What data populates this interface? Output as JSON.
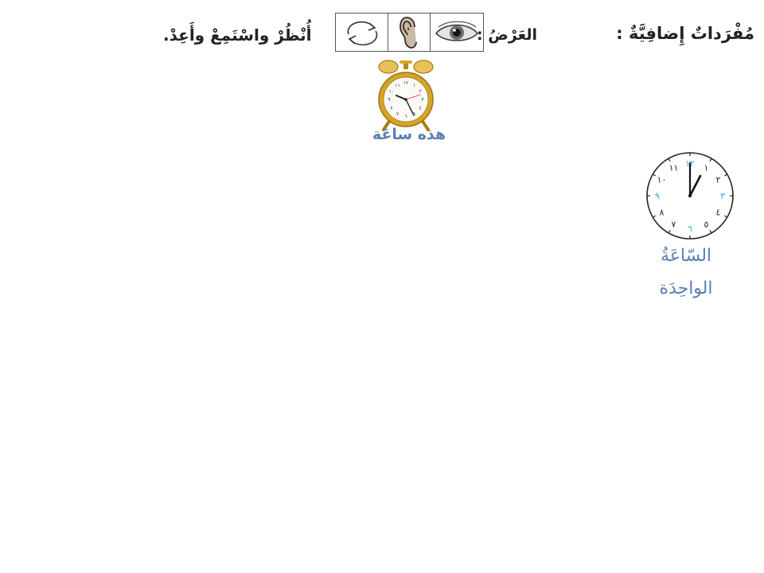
{
  "header": {
    "title": "مُفْرَداتٌ إِضافِيَّةٌ :",
    "section": "العَرْضُ :",
    "instruction": "أُنْظُرْ واسْتَمِعْ وأَعِدْ."
  },
  "icons": {
    "repeat": "repeat-arrows-icon",
    "ear": "ear-icon",
    "eye": "eye-icon"
  },
  "alarm_clock": {
    "icon": "alarm-clock-icon",
    "caption": "هذه ساعَة",
    "numerals": [
      "١٢",
      "١",
      "٢",
      "٣",
      "٤",
      "٥",
      "٦",
      "٧",
      "٨",
      "٩",
      "١٠",
      "١١"
    ]
  },
  "wall_clock": {
    "icon": "wall-clock-icon",
    "numerals": [
      "١٢",
      "١",
      "٢",
      "٣",
      "٤",
      "٥",
      "٦",
      "٧",
      "٨",
      "٩",
      "١٠",
      "١١"
    ],
    "caption_line1": "السّاعَةُ",
    "caption_line2": "الواحِدَة"
  },
  "colors": {
    "caption_blue": "#5a7fb4",
    "numeral_cyan": "#3aa6d8",
    "gold": "#d4a52a",
    "text_dark": "#222222"
  }
}
